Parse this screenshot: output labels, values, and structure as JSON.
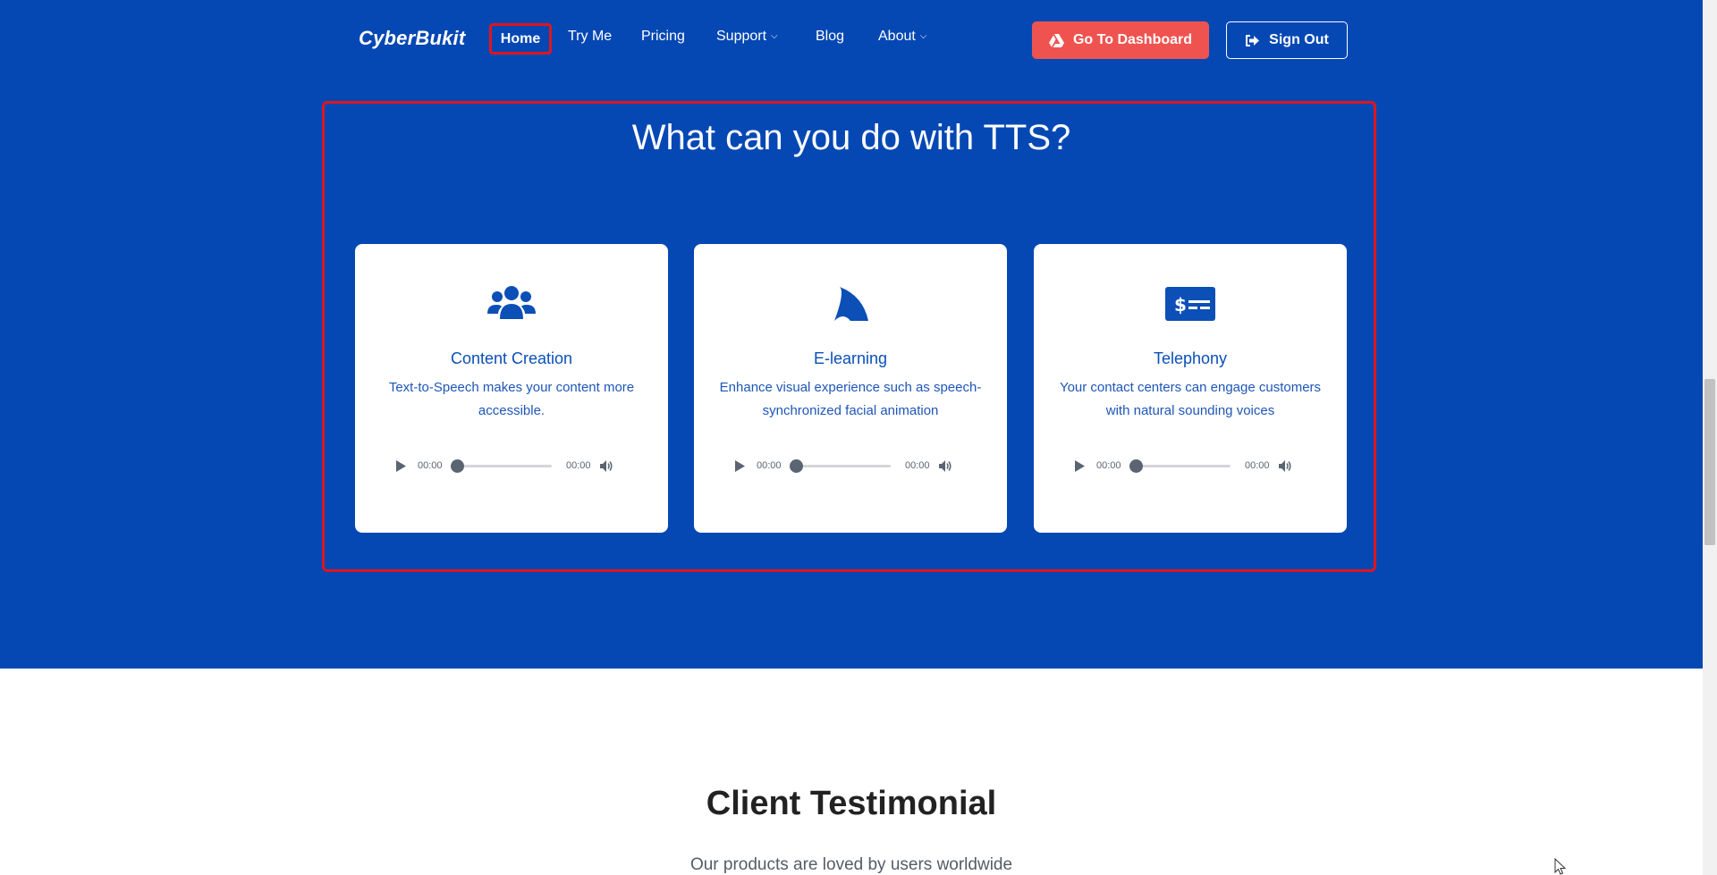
{
  "nav": {
    "brand": "CyberBukit",
    "links": {
      "home": "Home",
      "try_me": "Try Me",
      "pricing": "Pricing",
      "support": "Support",
      "blog": "Blog",
      "about": "About"
    },
    "dashboard_button": "Go To Dashboard",
    "signout_button": "Sign Out"
  },
  "section": {
    "title": "What can you do with TTS?",
    "cards": [
      {
        "icon": "users-icon",
        "title": "Content Creation",
        "description": "Text-to-Speech makes your content more accessible.",
        "time_current": "00:00",
        "time_total": "00:00"
      },
      {
        "icon": "shark-fin-icon",
        "title": "E-learning",
        "description": "Enhance visual experience such as speech-synchronized facial animation",
        "time_current": "00:00",
        "time_total": "00:00"
      },
      {
        "icon": "money-check-icon",
        "title": "Telephony",
        "description": "Your contact centers can engage customers with natural sounding voices",
        "time_current": "00:00",
        "time_total": "00:00"
      }
    ]
  },
  "testimonial": {
    "title": "Client Testimonial",
    "subtitle": "Our products are loved by users worldwide"
  },
  "colors": {
    "section_bg": "#0548b4",
    "accent_red": "#ef5350",
    "highlight": "#e0141e",
    "card_text": "#0b4fb7"
  }
}
